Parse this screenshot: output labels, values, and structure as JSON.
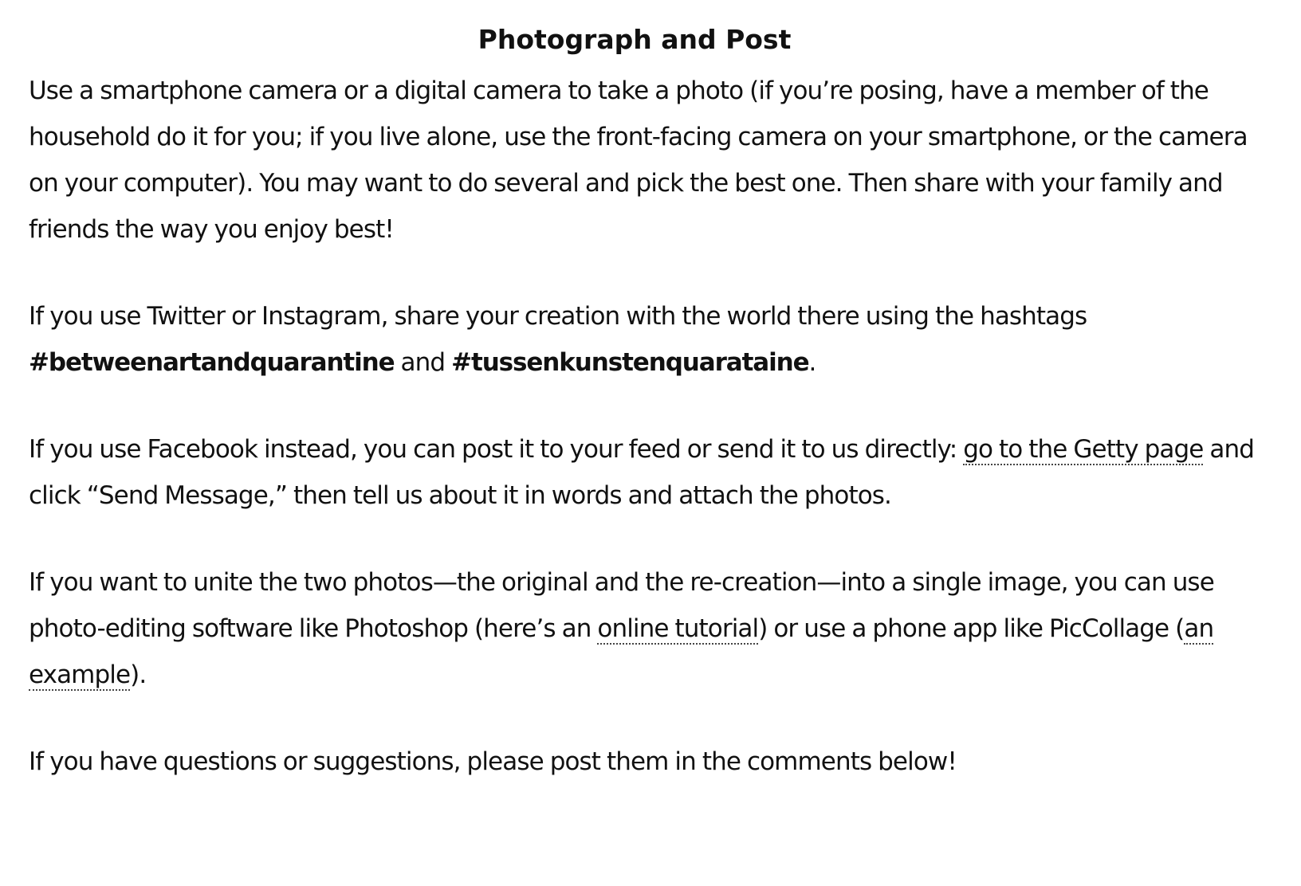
{
  "title": "Photograph and Post",
  "p1": {
    "text": "Use a smartphone camera or a digital camera to take a photo (if you’re posing, have a member of the household do it for you; if you live alone, use the front-facing camera on your smartphone, or the camera on your computer). You may want to do several and pick the best one. Then share with your family and friends the way you enjoy best!"
  },
  "p2": {
    "pre": "If you use Twitter or Instagram, share your creation with the world there using the hashtags ",
    "hashtag1": "#betweenartandquarantine",
    "mid": " and ",
    "hashtag2": "#tussenkunstenquarataine",
    "post": "."
  },
  "p3": {
    "pre": "If you use Facebook instead, you can post it to your feed or send it to us directly: ",
    "link": "go to the Getty page",
    "post": " and click “Send Message,” then tell us about it in words and attach the photos."
  },
  "p4": {
    "pre": "If you want to unite the two photos—the original and the re-creation—into a single image, you can use photo-editing software like Photoshop (here’s an ",
    "link1": "online tutorial",
    "mid": ") or use a phone app like PicCollage (",
    "link2": "an example",
    "post": ")."
  },
  "p5": {
    "text": "If you have questions or suggestions, please post them in the comments below!"
  }
}
